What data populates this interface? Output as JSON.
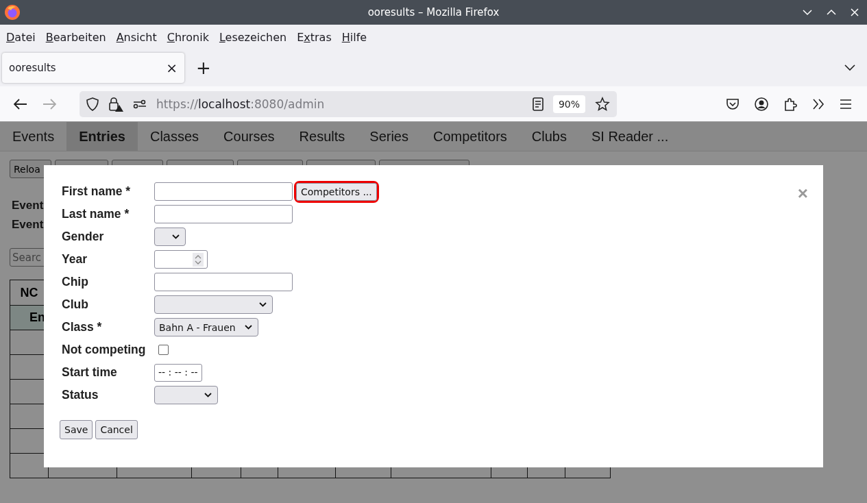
{
  "window": {
    "title": "ooresults – Mozilla Firefox"
  },
  "menu": [
    "Datei",
    "Bearbeiten",
    "Ansicht",
    "Chronik",
    "Lesezeichen",
    "Extras",
    "Hilfe"
  ],
  "browser_tab": {
    "title": "ooresults",
    "close": "×",
    "new_tab": "+"
  },
  "url": {
    "scheme": "https://",
    "host": "localhost",
    "rest": ":8080/admin"
  },
  "zoom": "90%",
  "page": {
    "nav": [
      {
        "label": "Events",
        "selected": false
      },
      {
        "label": "Entries",
        "selected": true
      },
      {
        "label": "Classes",
        "selected": false
      },
      {
        "label": "Courses",
        "selected": false
      },
      {
        "label": "Results",
        "selected": false
      },
      {
        "label": "Series",
        "selected": false
      },
      {
        "label": "Competitors",
        "selected": false
      },
      {
        "label": "Clubs",
        "selected": false
      },
      {
        "label": "SI Reader ...",
        "selected": false
      }
    ],
    "reload_button": "Reloa",
    "event_labels": [
      "Event",
      "Event"
    ],
    "search": {
      "placeholder": "Searc"
    },
    "table": {
      "column_1": "NC",
      "group_row": "En"
    }
  },
  "dialog": {
    "close": "×",
    "fields": [
      {
        "label": "First name *",
        "kind": "text",
        "button": {
          "label": "Competitors ...",
          "highlighted": true
        }
      },
      {
        "label": "Last name *",
        "kind": "text"
      },
      {
        "label": "Gender",
        "kind": "select"
      },
      {
        "label": "Year",
        "kind": "number"
      },
      {
        "label": "Chip",
        "kind": "text"
      },
      {
        "label": "Club",
        "kind": "select"
      },
      {
        "label": "Class *",
        "kind": "select",
        "value": "Bahn A - Frauen"
      },
      {
        "label": "Not competing",
        "kind": "checkbox",
        "checked": false
      },
      {
        "label": "Start time",
        "kind": "time",
        "placeholder": "-- : -- : --"
      },
      {
        "label": "Status",
        "kind": "select"
      }
    ],
    "buttons": [
      "Save",
      "Cancel"
    ]
  }
}
